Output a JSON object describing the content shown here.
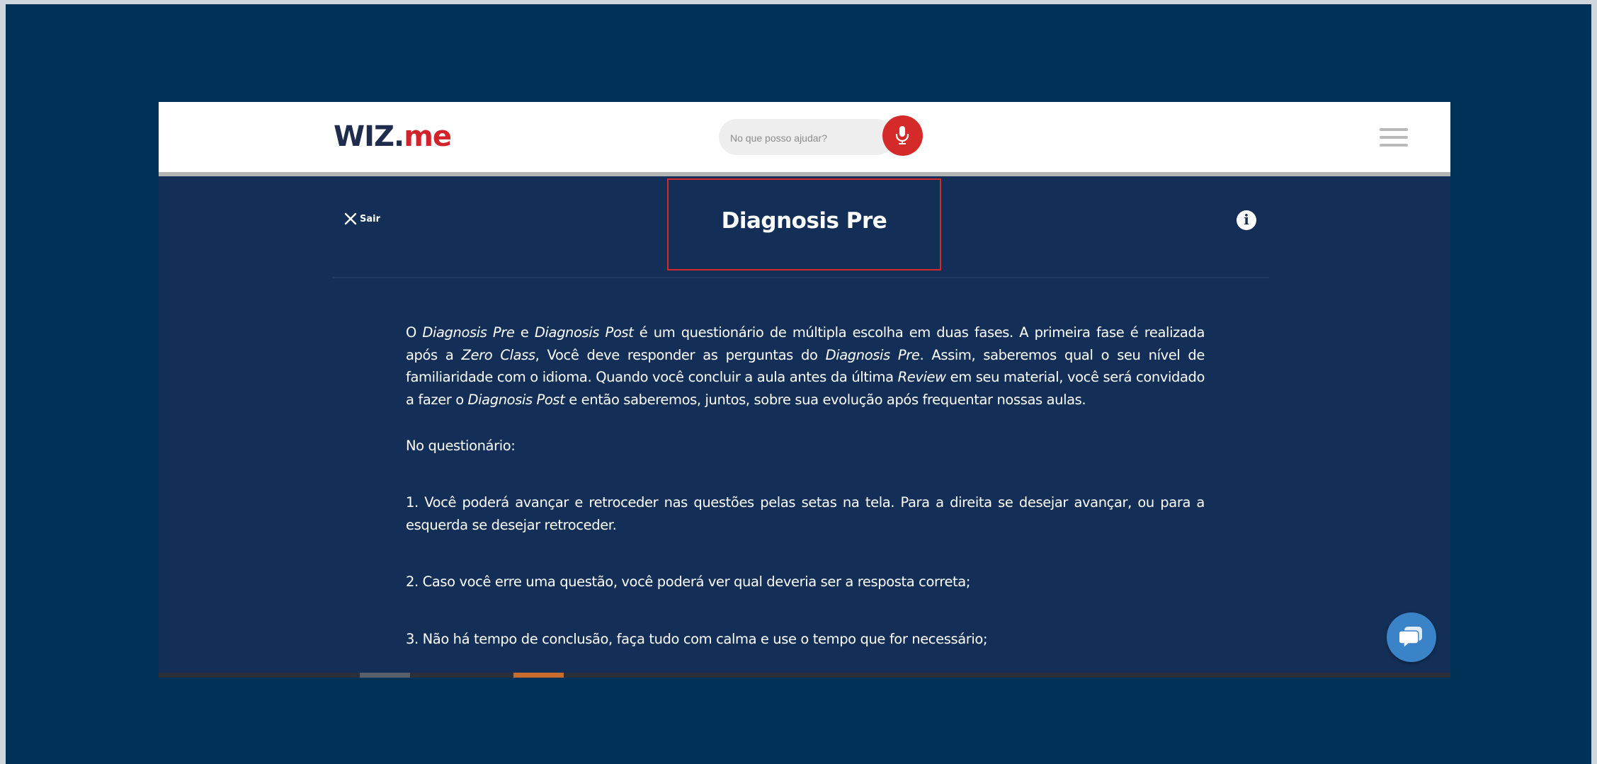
{
  "header": {
    "logo_text_wiz": "WIZ",
    "logo_text_dot": ".",
    "logo_text_me": "me",
    "search_placeholder": "No que posso ajudar?",
    "mic_icon": "microphone-icon",
    "menu_icon": "hamburger-menu-icon"
  },
  "panel": {
    "exit_label": "Sair",
    "exit_icon": "close-icon",
    "title": "Diagnosis Pre",
    "info_icon": "info-icon"
  },
  "content": {
    "intro": [
      {
        "text": "O ",
        "italic": false
      },
      {
        "text": "Diagnosis Pre",
        "italic": true
      },
      {
        "text": " e ",
        "italic": false
      },
      {
        "text": "Diagnosis Post",
        "italic": true
      },
      {
        "text": " é um questionário de múltipla escolha em duas fases. A primeira fase é realizada após a ",
        "italic": false
      },
      {
        "text": "Zero Class",
        "italic": true
      },
      {
        "text": ", Você deve responder as perguntas do ",
        "italic": false
      },
      {
        "text": "Diagnosis Pre",
        "italic": true
      },
      {
        "text": ". Assim, saberemos qual o seu nível de familiaridade com o idioma. Quando você concluir a aula antes da última ",
        "italic": false
      },
      {
        "text": "Review",
        "italic": true
      },
      {
        "text": " em seu material, você será convidado a fazer o ",
        "italic": false
      },
      {
        "text": "Diagnosis Post",
        "italic": true
      },
      {
        "text": " e então saberemos, juntos, sobre sua evolução após frequentar nossas aulas.",
        "italic": false
      }
    ],
    "questionario_label": "No questionário:",
    "item1": "1. Você poderá avançar e retroceder nas questões pelas setas na tela. Para a direita se desejar avançar, ou para a esquerda se desejar retroceder.",
    "item2": "2. Caso você erre uma questão, você poderá ver qual deveria ser a resposta correta;",
    "item3": "3. Não há tempo de conclusão, faça tudo com calma e use o tempo que for necessário;"
  },
  "chat": {
    "icon": "chat-bubble-icon"
  },
  "colors": {
    "desktop_bg": "#003156",
    "panel_bg": "#132f57",
    "brand_red": "#d52a2a",
    "brand_navy": "#1f2c4d",
    "chat_blue": "#3b83c8",
    "progress_active": "#c86d2e"
  }
}
